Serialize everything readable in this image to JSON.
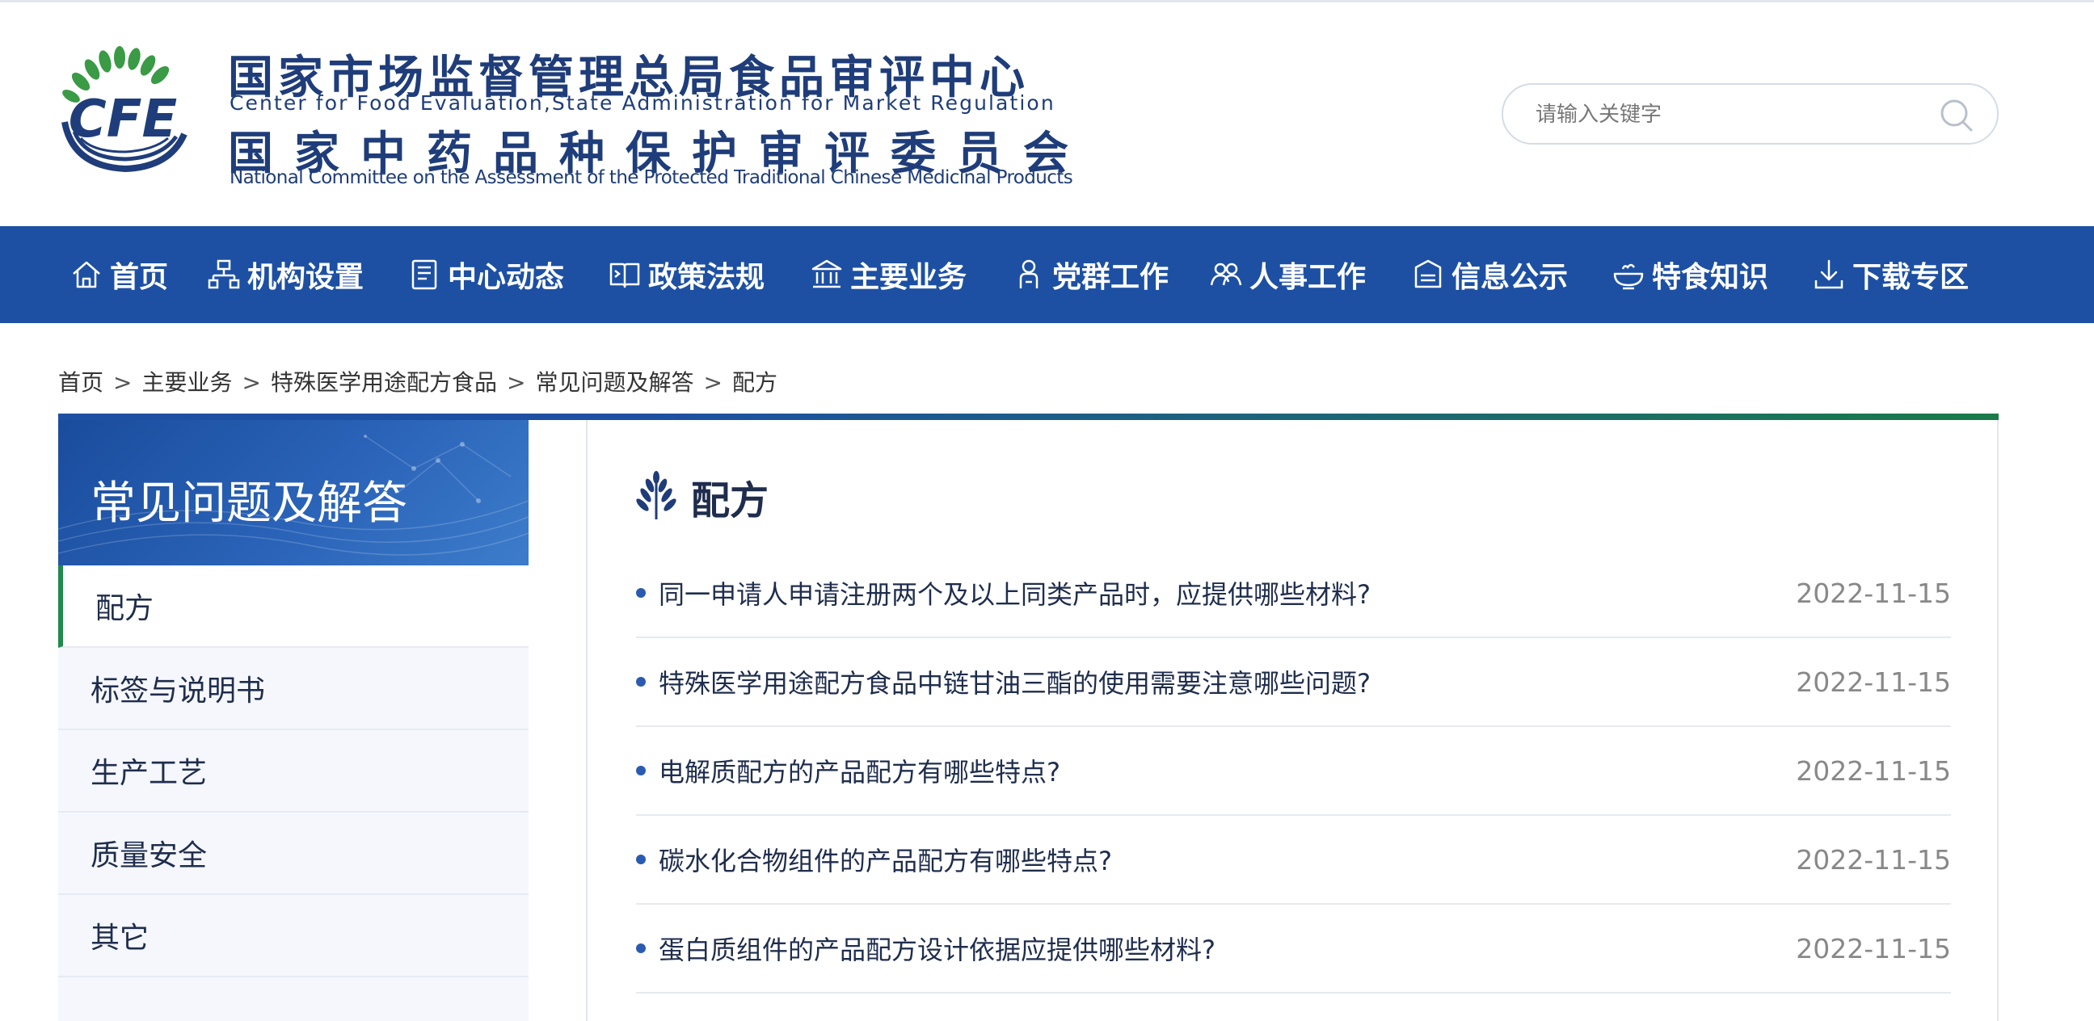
{
  "header": {
    "org_cn_1": "国家市场监督管理总局食品审评中心",
    "org_en_1": "Center for Food Evaluation,State Administration for Market Regulation",
    "org_cn_2": "国家中药品种保护审评委员会",
    "org_en_2": "National Committee on the Assessment of the Protected Traditional Chinese Medicinal Products",
    "logo_text": "CFE",
    "search_placeholder": "请输入关键字"
  },
  "nav": {
    "items": [
      {
        "label": "首页",
        "icon": "home-icon"
      },
      {
        "label": "机构设置",
        "icon": "org-chart-icon"
      },
      {
        "label": "中心动态",
        "icon": "document-icon"
      },
      {
        "label": "政策法规",
        "icon": "book-icon"
      },
      {
        "label": "主要业务",
        "icon": "building-icon"
      },
      {
        "label": "党群工作",
        "icon": "person-icon"
      },
      {
        "label": "人事工作",
        "icon": "people-icon"
      },
      {
        "label": "信息公示",
        "icon": "briefcase-icon"
      },
      {
        "label": "特食知识",
        "icon": "bowl-icon"
      },
      {
        "label": "下载专区",
        "icon": "download-icon"
      }
    ]
  },
  "breadcrumb": {
    "items": [
      "首页",
      "主要业务",
      "特殊医学用途配方食品",
      "常见问题及解答",
      "配方"
    ],
    "separator": ">"
  },
  "sidebar": {
    "title": "常见问题及解答",
    "items": [
      {
        "label": "配方",
        "active": true
      },
      {
        "label": "标签与说明书",
        "active": false
      },
      {
        "label": "生产工艺",
        "active": false
      },
      {
        "label": "质量安全",
        "active": false
      },
      {
        "label": "其它",
        "active": false
      }
    ]
  },
  "content": {
    "title": "配方",
    "title_icon": "wheat-icon",
    "articles": [
      {
        "title": "同一申请人申请注册两个及以上同类产品时，应提供哪些材料?",
        "date": "2022-11-15"
      },
      {
        "title": "特殊医学用途配方食品中链甘油三酯的使用需要注意哪些问题?",
        "date": "2022-11-15"
      },
      {
        "title": "电解质配方的产品配方有哪些特点?",
        "date": "2022-11-15"
      },
      {
        "title": "碳水化合物组件的产品配方有哪些特点?",
        "date": "2022-11-15"
      },
      {
        "title": "蛋白质组件的产品配方设计依据应提供哪些材料?",
        "date": "2022-11-15"
      }
    ]
  },
  "colors": {
    "nav_bg": "#1d50a3",
    "brand_blue": "#1f3d7a",
    "accent_green": "#1f8a4c",
    "date_gray": "#888888"
  }
}
